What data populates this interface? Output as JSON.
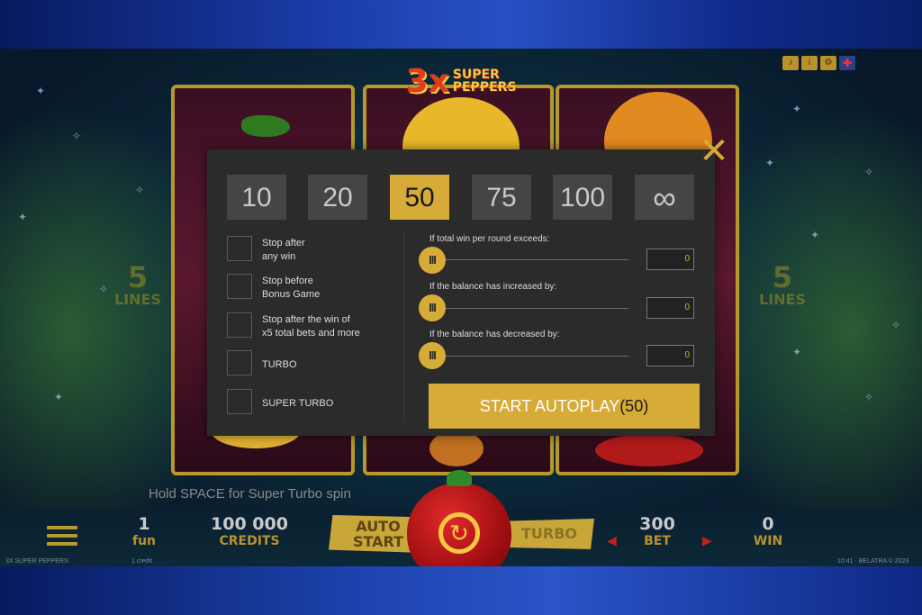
{
  "game": {
    "logo_big": "3x",
    "logo_small_1": "SUPER",
    "logo_small_2": "PEPPERS",
    "lines_number": "5",
    "lines_text": "LINES",
    "hint": "Hold SPACE for Super Turbo spin"
  },
  "bottom_bar": {
    "fun_value": "1",
    "fun_label": "fun",
    "credits_value": "100 000",
    "credits_label": "CREDITS",
    "auto_label_1": "AUTO",
    "auto_label_2": "START",
    "turbo_label": "TURBO",
    "bet_value": "300",
    "bet_label": "BET",
    "win_value": "0",
    "win_label": "WIN",
    "footer_left": "3X SUPER PEPPERS",
    "footer_mid": "1 credit",
    "footer_right": "10:41 · BELATRA © 2023"
  },
  "autoplay_modal": {
    "counts": [
      "10",
      "20",
      "50",
      "75",
      "100",
      "∞"
    ],
    "selected_count": "50",
    "options": [
      {
        "line1": "Stop after",
        "line2": "any win"
      },
      {
        "line1": "Stop before",
        "line2": "Bonus Game"
      },
      {
        "line1": "Stop after the win of",
        "line2": "x5 total bets and more"
      },
      {
        "line1": "TURBO",
        "line2": ""
      },
      {
        "line1": "SUPER TURBO",
        "line2": ""
      }
    ],
    "sliders": [
      {
        "label": "If total win per round exceeds:",
        "value": "0",
        "knob": "III"
      },
      {
        "label": "If the balance has increased by:",
        "value": "0",
        "knob": "III"
      },
      {
        "label": "If the balance has decreased by:",
        "value": "0",
        "knob": "III"
      }
    ],
    "start_label": "START AUTOPLAY",
    "start_count": "(50)",
    "close_glyph": "✕"
  },
  "colors": {
    "accent": "#d7ab37",
    "modal_bg": "#2b2b2b",
    "button_bg": "#454545"
  }
}
